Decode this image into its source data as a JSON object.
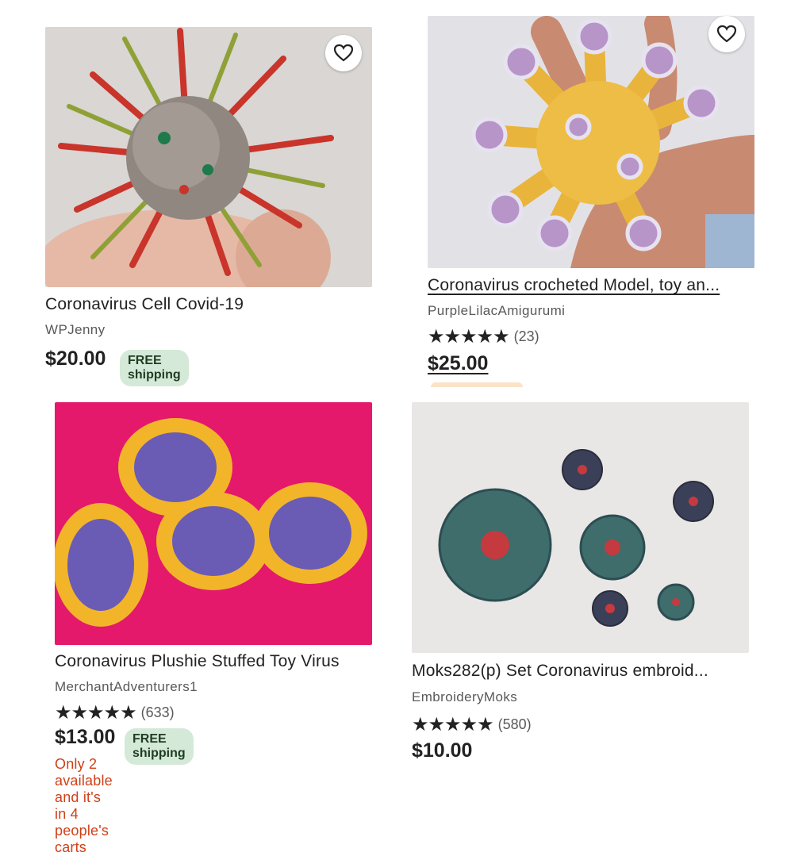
{
  "listings": [
    {
      "title": "Coronavirus Cell Covid-19",
      "shop": "WPJenny",
      "price": "$20.00",
      "badge": "FREE shipping",
      "image_icon": "beaded-virus-image"
    },
    {
      "title": "Coronavirus crocheted Model, toy an...",
      "shop": "PurpleLilacAmigurumi",
      "stars": "★★★★★",
      "reviews": "(23)",
      "price": "$25.00",
      "image_icon": "crochet-virus-image"
    },
    {
      "title": "Coronavirus Plushie Stuffed Toy Virus",
      "shop": "MerchantAdventurers1",
      "stars": "★★★★★",
      "reviews": "(633)",
      "price": "$13.00",
      "badge": "FREE shipping",
      "scarcity": "Only 2 available and it's in 4 people's carts",
      "image_icon": "plush-virus-image"
    },
    {
      "title": "Moks282(p) Set Coronavirus embroid...",
      "shop": "EmbroideryMoks",
      "stars": "★★★★★",
      "reviews": "(580)",
      "price": "$10.00",
      "image_icon": "embroidered-virus-image"
    }
  ],
  "colors": {
    "badge_bg": "#d4e9d7",
    "scarcity_text": "#cf4018",
    "plush_background": "#e4196b"
  }
}
